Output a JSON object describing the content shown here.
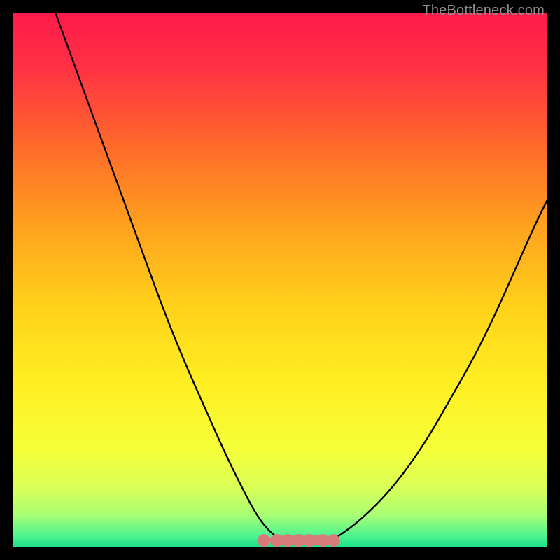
{
  "watermark": "TheBottleneck.com",
  "chart_data": {
    "type": "line",
    "title": "",
    "xlabel": "",
    "ylabel": "",
    "xlim": [
      0,
      100
    ],
    "ylim": [
      0,
      100
    ],
    "series": [
      {
        "name": "left-curve",
        "x": [
          8,
          12,
          16,
          20,
          24,
          28,
          32,
          36,
          40,
          44,
          46,
          48,
          50
        ],
        "y": [
          100,
          89,
          78,
          67,
          56,
          45,
          35,
          26,
          17,
          9,
          5.5,
          3,
          1.5
        ]
      },
      {
        "name": "right-curve",
        "x": [
          60,
          63,
          66,
          70,
          74,
          78,
          82,
          86,
          90,
          94,
          98,
          100
        ],
        "y": [
          1.5,
          3.5,
          6,
          10,
          15,
          21,
          28,
          35,
          43,
          52,
          61,
          65
        ]
      },
      {
        "name": "optimal-flat-band",
        "x": [
          47,
          60
        ],
        "y": [
          1.3,
          1.3
        ]
      }
    ],
    "gradient_stops": [
      {
        "offset": 0.0,
        "color": "#ff1a4b"
      },
      {
        "offset": 0.1,
        "color": "#ff3044"
      },
      {
        "offset": 0.25,
        "color": "#ff6a2a"
      },
      {
        "offset": 0.4,
        "color": "#ffa21e"
      },
      {
        "offset": 0.55,
        "color": "#ffd21a"
      },
      {
        "offset": 0.7,
        "color": "#fff023"
      },
      {
        "offset": 0.82,
        "color": "#f5ff3a"
      },
      {
        "offset": 0.89,
        "color": "#d8ff58"
      },
      {
        "offset": 0.94,
        "color": "#a8ff75"
      },
      {
        "offset": 0.975,
        "color": "#55f58e"
      },
      {
        "offset": 1.0,
        "color": "#18e08a"
      }
    ],
    "highlight_color": "#d77a7a",
    "highlight_points_x": [
      47,
      49.5,
      51.5,
      53.5,
      55.5,
      58,
      60
    ],
    "highlight_segment": {
      "x1": 49,
      "x2": 58
    }
  }
}
